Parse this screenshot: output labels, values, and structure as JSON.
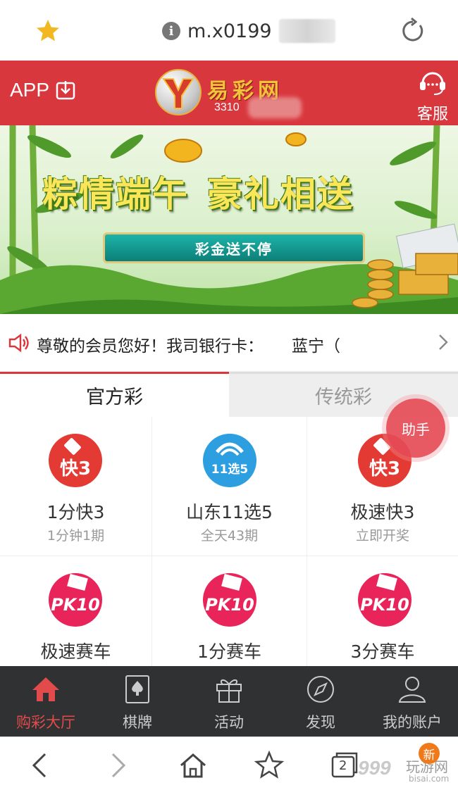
{
  "browser": {
    "url": "m.x0199",
    "icons": {
      "favorite": "star-icon",
      "info": "info-icon",
      "reload": "reload-icon"
    },
    "star_color": "#f2b824"
  },
  "header": {
    "app_label": "APP",
    "logo_text": "易彩网",
    "logo_sub": "3310",
    "service_label": "客服",
    "bg_color": "#d9373e"
  },
  "banner": {
    "title_left": "粽情端午",
    "title_right": "豪礼相送",
    "ribbon": "彩金送不停"
  },
  "notice": {
    "text_main": "尊敬的会员您好！我司银行卡：",
    "text_tail": "蓝宁（"
  },
  "tabs": [
    {
      "label": "官方彩",
      "active": true
    },
    {
      "label": "传统彩",
      "active": false
    }
  ],
  "games": [
    {
      "name": "1分快3",
      "sub": "1分钟1期",
      "icon": "k3-icon"
    },
    {
      "name": "山东11选5",
      "sub": "全天43期",
      "icon": "11x5-icon"
    },
    {
      "name": "极速快3",
      "sub": "立即开奖",
      "icon": "k3-icon"
    },
    {
      "name": "极速赛车",
      "sub": "",
      "icon": "pk10-icon"
    },
    {
      "name": "1分赛车",
      "sub": "",
      "icon": "pk10-icon"
    },
    {
      "name": "3分赛车",
      "sub": "",
      "icon": "pk10-icon"
    }
  ],
  "helper_label": "助手",
  "bottom_nav": [
    {
      "label": "购彩大厅",
      "icon": "home-icon",
      "active": true
    },
    {
      "label": "棋牌",
      "icon": "cards-icon",
      "active": false
    },
    {
      "label": "活动",
      "icon": "gift-icon",
      "active": false
    },
    {
      "label": "发现",
      "icon": "compass-icon",
      "active": false
    },
    {
      "label": "我的账户",
      "icon": "user-icon",
      "active": false
    }
  ],
  "browser_bottom": {
    "tab_count": "2",
    "new_badge": "新",
    "watermark": "999",
    "watermark_site": "玩游网",
    "watermark_domain": "bisai.com"
  }
}
